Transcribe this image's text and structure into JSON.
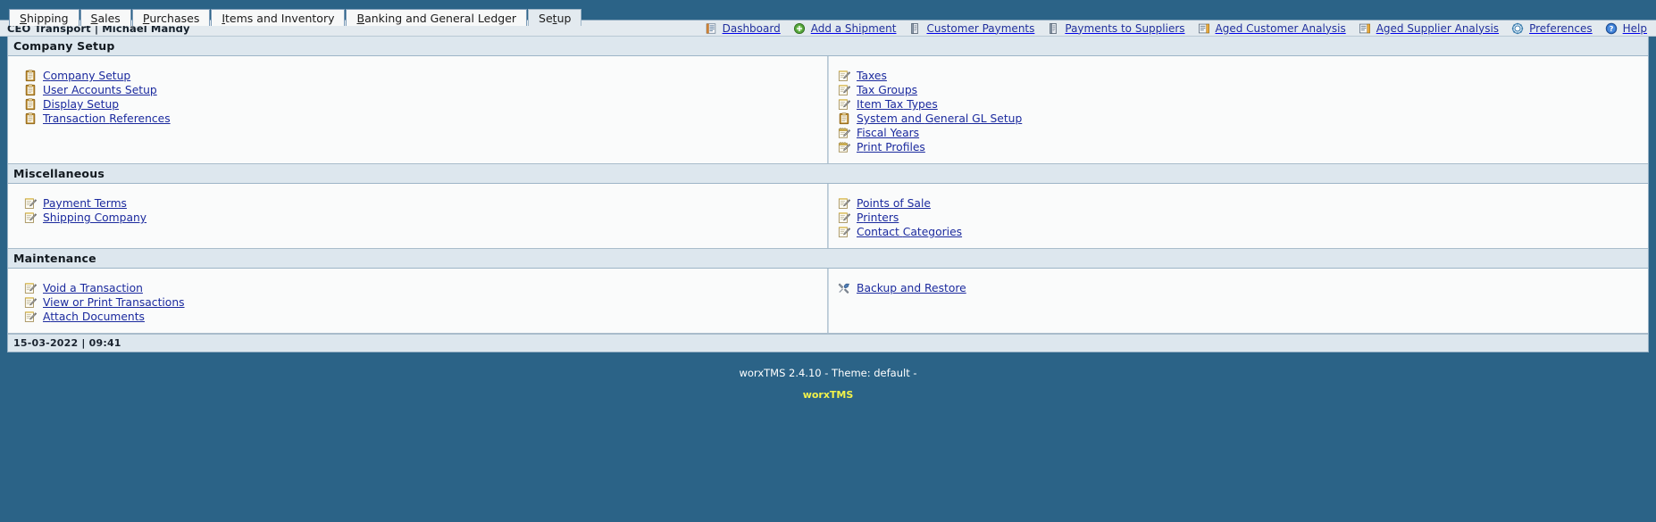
{
  "tabs": [
    {
      "name": "tab-shipping",
      "pre": "",
      "akey": "S",
      "post": "hipping",
      "active": false
    },
    {
      "name": "tab-sales",
      "pre": "",
      "akey": "S",
      "post": "ales",
      "active": false
    },
    {
      "name": "tab-purchases",
      "pre": "",
      "akey": "P",
      "post": "urchases",
      "active": false
    },
    {
      "name": "tab-items-and-inventory",
      "pre": "",
      "akey": "I",
      "post": "tems and Inventory",
      "active": false
    },
    {
      "name": "tab-banking-and-general-ledger",
      "pre": "",
      "akey": "B",
      "post": "anking and General Ledger",
      "active": false
    },
    {
      "name": "tab-setup",
      "pre": "Se",
      "akey": "t",
      "post": "up",
      "active": true
    }
  ],
  "userbar": {
    "company": "CEO Transport",
    "separator": "|",
    "user": "Michael Mandy",
    "info": "CEO Transport | Michael Mandy"
  },
  "toolbar": [
    {
      "name": "toolbar-dashboard",
      "label": "Dashboard",
      "icon": "dashboard-icon"
    },
    {
      "name": "toolbar-add-a-shipment",
      "label": "Add a Shipment",
      "icon": "add-circle-icon"
    },
    {
      "name": "toolbar-customer-payments",
      "label": "Customer Payments",
      "icon": "payment-book-icon"
    },
    {
      "name": "toolbar-payments-to-suppliers",
      "label": "Payments to Suppliers",
      "icon": "payment-book-icon"
    },
    {
      "name": "toolbar-aged-customer-analysis",
      "label": "Aged Customer Analysis",
      "icon": "report-icon"
    },
    {
      "name": "toolbar-aged-supplier-analysis",
      "label": "Aged Supplier Analysis",
      "icon": "report-icon"
    },
    {
      "name": "toolbar-preferences",
      "label": "Preferences",
      "icon": "gear-icon"
    },
    {
      "name": "toolbar-help",
      "label": "Help",
      "icon": "help-icon"
    }
  ],
  "panels": [
    {
      "name": "panel-company-setup",
      "title": "Company Setup",
      "left": [
        {
          "name": "link-company-setup",
          "pre": "",
          "akey": "C",
          "post": "ompany Setup",
          "icon": "clipboard-icon"
        },
        {
          "name": "link-user-accounts-setup",
          "pre": "",
          "akey": "U",
          "post": "ser Accounts Setup",
          "icon": "clipboard-icon"
        },
        {
          "name": "link-display-setup",
          "pre": "",
          "akey": "D",
          "post": "isplay Setup",
          "icon": "clipboard-icon"
        },
        {
          "name": "link-transaction-references",
          "pre": "Transaction ",
          "akey": "R",
          "post": "eferences",
          "icon": "clipboard-icon"
        }
      ],
      "right": [
        {
          "name": "link-taxes",
          "pre": "",
          "akey": "T",
          "post": "axes",
          "icon": "edit-note-icon"
        },
        {
          "name": "link-tax-groups",
          "pre": "Tax ",
          "akey": "G",
          "post": "roups",
          "icon": "edit-note-icon"
        },
        {
          "name": "link-item-tax-types",
          "pre": "Item Ta",
          "akey": "x",
          "post": " Types",
          "icon": "edit-note-icon"
        },
        {
          "name": "link-system-and-general-gl-setup",
          "pre": "System and ",
          "akey": "G",
          "post": "eneral GL Setup",
          "icon": "clipboard-icon"
        },
        {
          "name": "link-fiscal-years",
          "pre": "",
          "akey": "F",
          "post": "iscal Years",
          "icon": "calendar-edit-icon"
        },
        {
          "name": "link-print-profiles",
          "pre": "",
          "akey": "P",
          "post": "rint Profiles",
          "icon": "calendar-edit-icon"
        }
      ]
    },
    {
      "name": "panel-miscellaneous",
      "title": "Miscellaneous",
      "left": [
        {
          "name": "link-payment-terms",
          "pre": "Pa",
          "akey": "y",
          "post": "ment Terms",
          "icon": "edit-note-icon"
        },
        {
          "name": "link-shipping-company",
          "pre": "Shi",
          "akey": "p",
          "post": "ping Company",
          "icon": "edit-note-icon"
        }
      ],
      "right": [
        {
          "name": "link-points-of-sale",
          "pre": "",
          "akey": "P",
          "post": "oints of Sale",
          "icon": "edit-note-icon"
        },
        {
          "name": "link-printers",
          "pre": "",
          "akey": "P",
          "post": "rinters",
          "icon": "edit-note-icon"
        },
        {
          "name": "link-contact-categories",
          "pre": "Contact ",
          "akey": "C",
          "post": "ategories",
          "icon": "edit-note-icon"
        }
      ]
    },
    {
      "name": "panel-maintenance",
      "title": "Maintenance",
      "left": [
        {
          "name": "link-void-a-transaction",
          "pre": "",
          "akey": "V",
          "post": "oid a Transaction",
          "icon": "edit-note-icon"
        },
        {
          "name": "link-view-or-print-transactions",
          "pre": "View or ",
          "akey": "P",
          "post": "rint Transactions",
          "icon": "edit-note-icon"
        },
        {
          "name": "link-attach-documents",
          "pre": "",
          "akey": "A",
          "post": "ttach Documents",
          "icon": "edit-note-icon"
        }
      ],
      "right": [
        {
          "name": "link-backup-and-restore",
          "pre": "",
          "akey": "B",
          "post": "ackup and Restore",
          "icon": "tools-icon"
        }
      ]
    }
  ],
  "statusbar": {
    "date": "15-03-2022",
    "time": "09:41",
    "text": "15-03-2022 | 09:41"
  },
  "footer": {
    "version_line": "worxTMS 2.4.10 - Theme: default -",
    "brand": "worxTMS"
  },
  "colors": {
    "page_background": "#2b6387",
    "panel_header": "#dde7ee",
    "link": "#1b2a9e",
    "brand": "#f2f24a"
  }
}
